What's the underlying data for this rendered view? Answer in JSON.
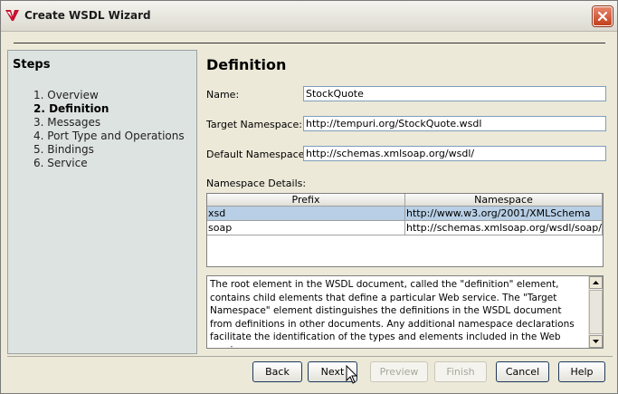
{
  "window": {
    "title": "Create WSDL Wizard"
  },
  "steps": {
    "title": "Steps",
    "items": [
      {
        "label": "1. Overview",
        "current": false
      },
      {
        "label": "2. Definition",
        "current": true
      },
      {
        "label": "3. Messages",
        "current": false
      },
      {
        "label": "4. Port Type and Operations",
        "current": false
      },
      {
        "label": "5. Bindings",
        "current": false
      },
      {
        "label": "6. Service",
        "current": false
      }
    ]
  },
  "form": {
    "heading": "Definition",
    "name_label": "Name:",
    "name_value": "StockQuote",
    "target_ns_label": "Target Namespace:",
    "target_ns_value": "http://tempuri.org/StockQuote.wsdl",
    "default_ns_label": "Default Namespace:",
    "default_ns_value": "http://schemas.xmlsoap.org/wsdl/"
  },
  "namespace_details": {
    "label": "Namespace Details:",
    "columns": [
      "Prefix",
      "Namespace"
    ],
    "rows": [
      {
        "prefix": "xsd",
        "namespace": "http://www.w3.org/2001/XMLSchema",
        "selected": true
      },
      {
        "prefix": "soap",
        "namespace": "http://schemas.xmlsoap.org/wsdl/soap/",
        "selected": false
      }
    ]
  },
  "description": "The root element in the WSDL document, called the \"definition\" element, contains child elements that define a particular Web service. The \"Target Namespace\" element distinguishes the definitions in the WSDL document from definitions in other documents. Any additional namespace declarations facilitate the identification of the types and elements included in the Web service.",
  "buttons": {
    "back": "Back",
    "next": "Next",
    "preview": "Preview",
    "finish": "Finish",
    "cancel": "Cancel",
    "help": "Help"
  },
  "colors": {
    "selection": "#b8cfe5",
    "steps_panel": "#dde3e1",
    "close_button": "#c2401c"
  }
}
